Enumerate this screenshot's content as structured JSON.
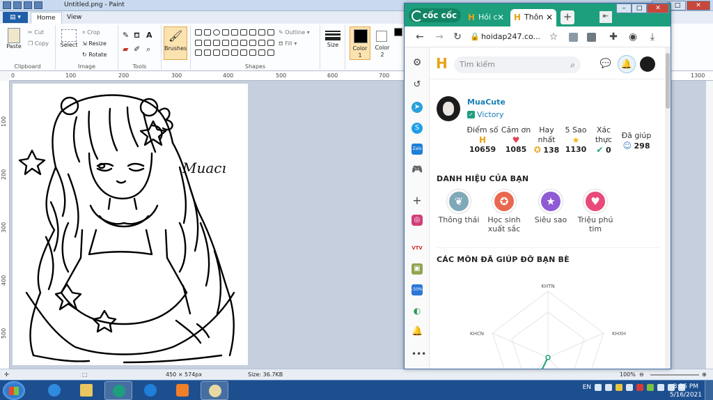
{
  "paint": {
    "title": "Untitled.png - Paint",
    "tabs": [
      "Home",
      "View"
    ],
    "groups": {
      "clipboard": {
        "label": "Clipboard",
        "paste": "Paste",
        "cut": "Cut",
        "copy": "Copy"
      },
      "image": {
        "label": "Image",
        "select": "Select",
        "crop": "Crop",
        "resize": "Resize",
        "rotate": "Rotate"
      },
      "tools": {
        "label": "Tools"
      },
      "brushes": {
        "label": "Brushes"
      },
      "shapes": {
        "label": "Shapes",
        "outline": "Outline",
        "fill": "Fill"
      },
      "size": {
        "label": "Size"
      },
      "color1": {
        "label": "Color",
        "num": "1"
      },
      "color2": {
        "label": "Color",
        "num": "2"
      }
    },
    "ruler_h": [
      "0",
      "100",
      "200",
      "300",
      "400",
      "500",
      "600",
      "700",
      "1300"
    ],
    "ruler_v": [
      "100",
      "200",
      "300",
      "400",
      "500"
    ],
    "canvas_signature": "Muacı",
    "status": {
      "dimensions": "450 × 574px",
      "size": "Size: 36.7KB",
      "zoom": "100%"
    }
  },
  "browser": {
    "logo": "cốc cốc",
    "tabs": [
      {
        "label": "Hỏi c",
        "active": false
      },
      {
        "label": "Thôn",
        "active": true
      }
    ],
    "url": "hoidap247.co...",
    "search_placeholder": "Tìm kiếm",
    "site_logo": "H",
    "profile": {
      "name": "MuaCute",
      "rank": "Victory"
    },
    "stats": [
      {
        "label": "Điểm số",
        "icon": "H",
        "value": "10659"
      },
      {
        "label": "Cảm ơn",
        "icon": "♥",
        "value": "1085"
      },
      {
        "label": "Hay nhất",
        "icon": "✪",
        "value": "138"
      },
      {
        "label": "5 Sao",
        "icon": "★",
        "value": "1130"
      },
      {
        "label": "Xác thực",
        "icon": "✔",
        "value": "0"
      },
      {
        "label": "Đã giúp",
        "icon": "☺",
        "value": "298"
      }
    ],
    "titles_heading": "DANH HIỆU CỦA BẠN",
    "titles": [
      {
        "label": "Thông thái",
        "color": "#7fa9b8"
      },
      {
        "label": "Học sinh xuất sắc",
        "color": "#e8674f"
      },
      {
        "label": "Siêu sao",
        "color": "#8e5bd4"
      },
      {
        "label": "Triệu phú tim",
        "color": "#e84a7a"
      }
    ],
    "subjects_heading": "CÁC MÔN ĐÃ GIÚP ĐỠ BẠN BÈ",
    "radar_labels": {
      "top": "KHTN",
      "left": "KHCN",
      "right": "KHXH"
    }
  },
  "taskbar": {
    "language": "EN",
    "time": "3:55 PM",
    "date": "5/16/2021"
  },
  "colors": {
    "coccoc_green": "#1d9e7d",
    "hoidap_yellow": "#e8a317",
    "link_blue": "#1a7fb5"
  }
}
